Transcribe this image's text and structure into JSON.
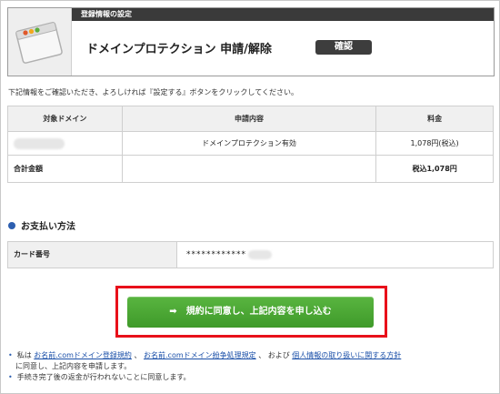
{
  "header": {
    "section_label": "登録情報の設定",
    "title": "ドメインプロテクション 申請/解除",
    "badge": "確認"
  },
  "intro_text": "下記情報をご確認いただき、よろしければ『設定する』ボタンをクリックしてください。",
  "order_table": {
    "columns": [
      "対象ドメイン",
      "申請内容",
      "料金"
    ],
    "row": {
      "service": "ドメインプロテクション有効",
      "price": "1,078円(税込)"
    },
    "total_label": "合計金額",
    "total_value": "税込1,078円"
  },
  "payment": {
    "title": "お支払い方法",
    "card_label": "カード番号",
    "card_value": "************"
  },
  "submit": {
    "label": "規約に同意し、上記内容を申し込む",
    "icon": "arrow-right-icon"
  },
  "terms": {
    "prefix": "私は",
    "link1": "お名前.comドメイン登録規約",
    "sep1": "、",
    "link2": "お名前.comドメイン紛争処理規定",
    "sep2": "、 および",
    "link3": "個人情報の取り扱いに関する方針",
    "line2": "に同意し、上記内容を申請します。",
    "line3": "手続き完了後の返金が行われないことに同意します。"
  },
  "colors": {
    "accent_green": "#4caf3a",
    "highlight_red": "#e8101a",
    "link_blue": "#1a4fa8",
    "dark_bar": "#3a3a3a"
  }
}
